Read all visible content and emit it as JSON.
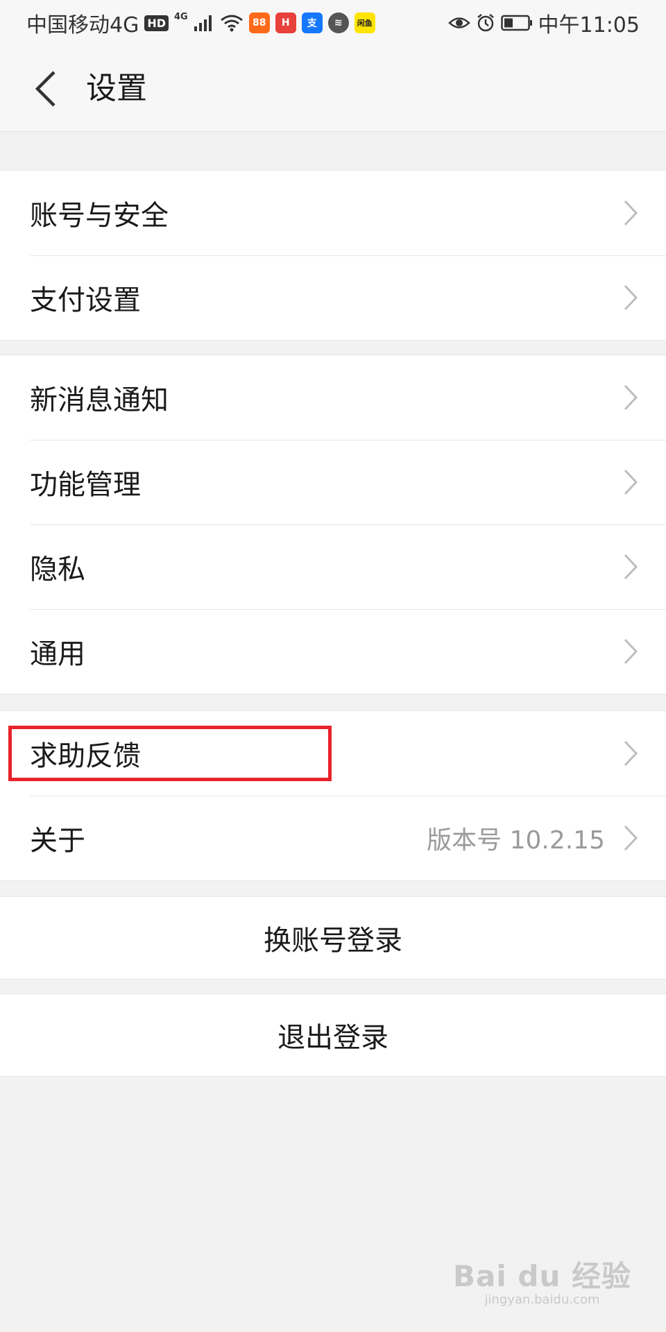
{
  "statusbar": {
    "carrier": "中国移动4G",
    "hd": "HD",
    "net": "4G",
    "time": "中午11:05",
    "app_icons": [
      {
        "name": "kuaishou-icon",
        "text": "88",
        "color": "#ff6a1a"
      },
      {
        "name": "huawei-appgallery-icon",
        "text": "H",
        "color": "#e8413c"
      },
      {
        "name": "alipay-icon",
        "text": "支",
        "color": "#1677ff"
      },
      {
        "name": "voice-assistant-icon",
        "text": "≋",
        "color": "#555555"
      },
      {
        "name": "xianyu-icon",
        "text": "闲鱼",
        "color": "#ffe400"
      }
    ]
  },
  "navbar": {
    "title": "设置"
  },
  "groups": [
    {
      "items": [
        {
          "label": "账号与安全"
        },
        {
          "label": "支付设置"
        }
      ]
    },
    {
      "items": [
        {
          "label": "新消息通知"
        },
        {
          "label": "功能管理"
        },
        {
          "label": "隐私"
        },
        {
          "label": "通用"
        }
      ]
    },
    {
      "items": [
        {
          "label": "求助反馈"
        },
        {
          "label": "关于",
          "value": "版本号 10.2.15"
        }
      ]
    }
  ],
  "actions": {
    "switch_account": "换账号登录",
    "logout": "退出登录"
  },
  "watermark": {
    "brand": "Bai du 经验",
    "url": "jingyan.baidu.com"
  },
  "colors": {
    "highlight": "#e8232b",
    "background": "#f2f2f2"
  }
}
